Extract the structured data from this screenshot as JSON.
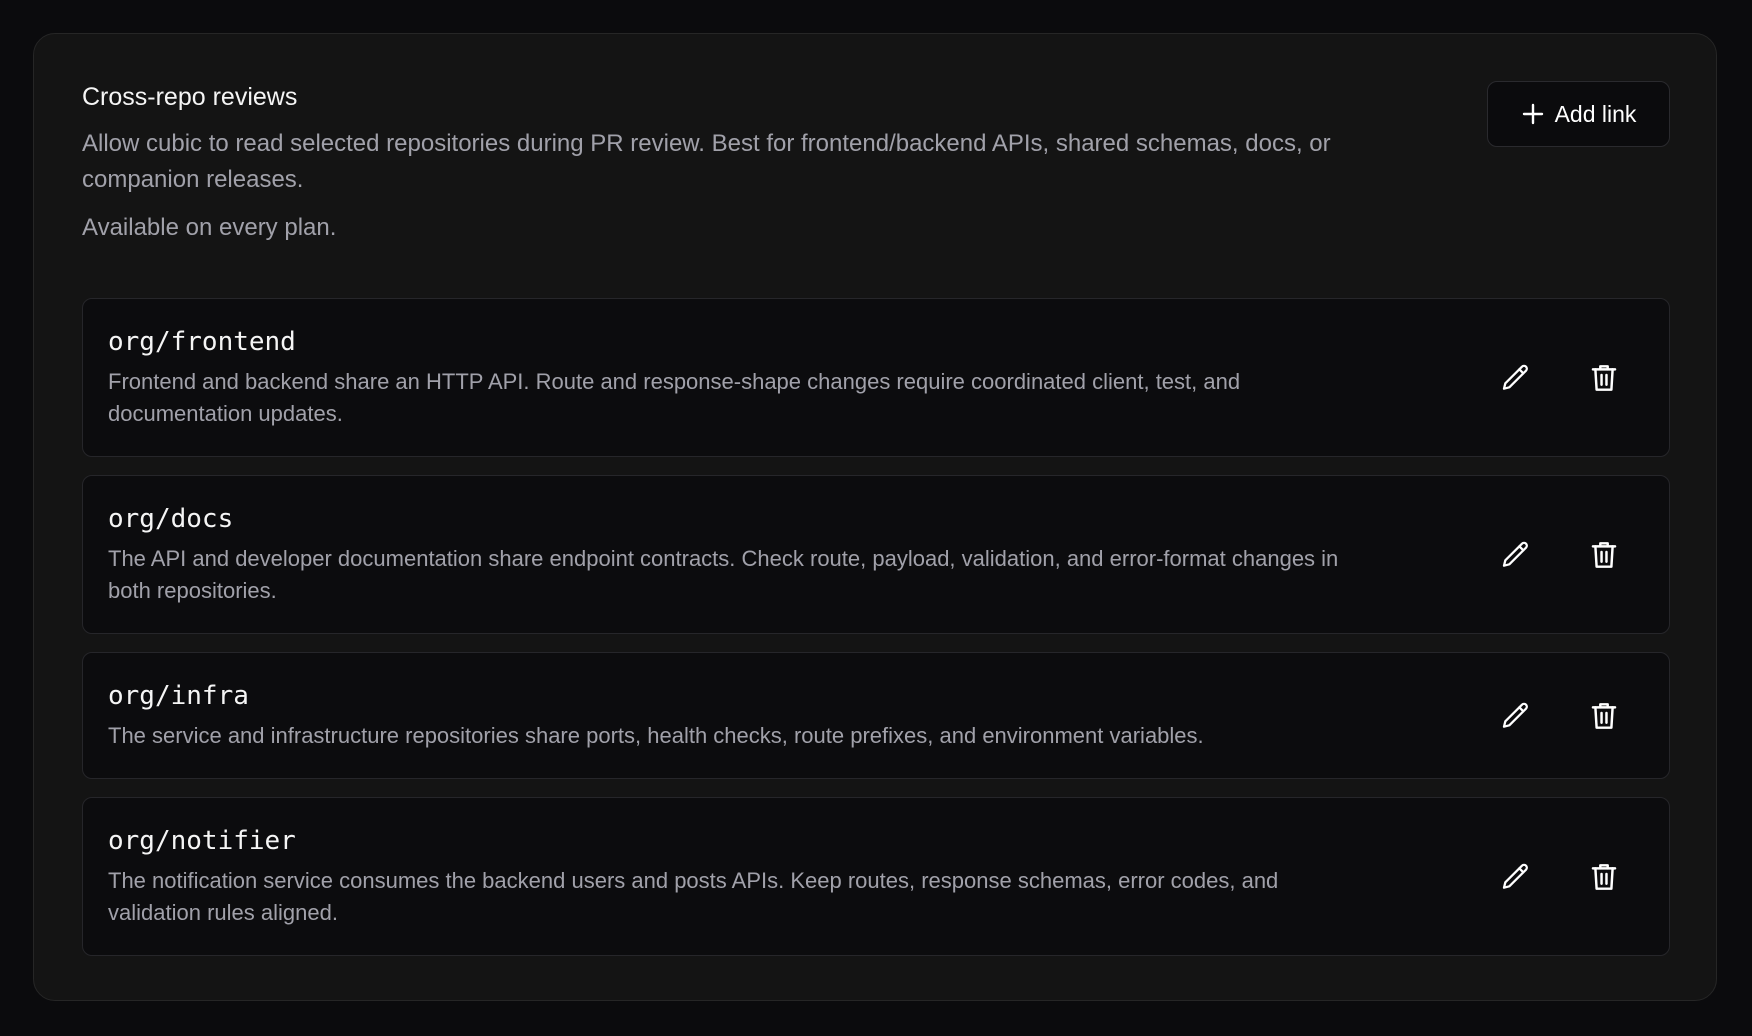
{
  "section": {
    "title": "Cross-repo reviews",
    "description": "Allow cubic to read selected repositories during PR review. Best for frontend/backend APIs, shared schemas, docs, or companion releases.",
    "availability": "Available on every plan."
  },
  "add_button": {
    "label": "Add link",
    "icon": "plus-icon"
  },
  "links": [
    {
      "repo": "org/frontend",
      "description": "Frontend and backend share an HTTP API. Route and response-shape changes require coordinated client, test, and documentation updates."
    },
    {
      "repo": "org/docs",
      "description": "The API and developer documentation share endpoint contracts. Check route, payload, validation, and error-format changes in both repositories."
    },
    {
      "repo": "org/infra",
      "description": "The service and infrastructure repositories share ports, health checks, route prefixes, and environment variables."
    },
    {
      "repo": "org/notifier",
      "description": "The notification service consumes the backend users and posts APIs. Keep routes, response schemas, error codes, and validation rules aligned."
    }
  ],
  "row_actions": [
    "pencil-icon",
    "trash-icon"
  ],
  "colors": {
    "background": "#0b0b0d",
    "card": "#141414",
    "row": "#0c0c0e",
    "border": "#26262a",
    "text": "#f5f5f5",
    "muted": "#a1a1aa"
  }
}
